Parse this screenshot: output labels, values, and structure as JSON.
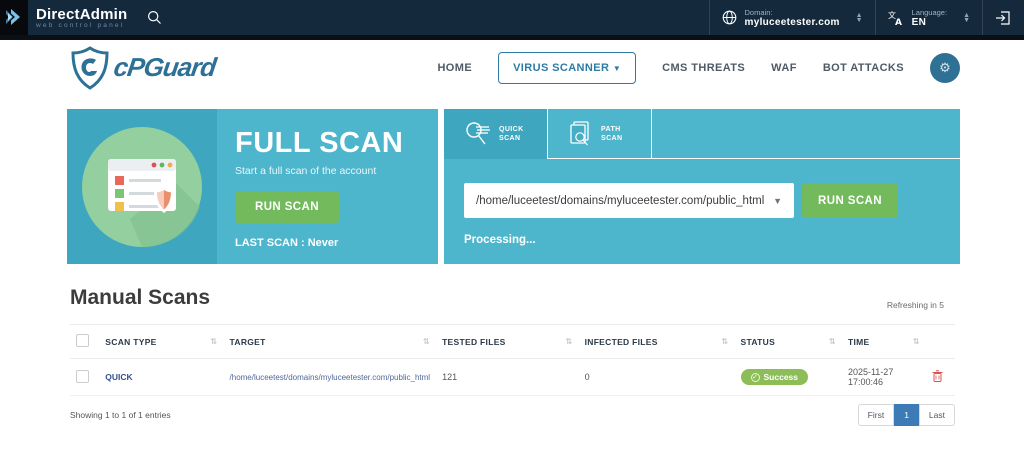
{
  "topbar": {
    "brand": "DirectAdmin",
    "brand_sub": "web control panel",
    "domain_label": "Domain:",
    "domain_value": "myluceetester.com",
    "language_label": "Language:",
    "language_value": "EN"
  },
  "nav": {
    "logo_text": "cPGuard",
    "items": {
      "home": "HOME",
      "virus_scanner": "VIRUS SCANNER",
      "cms_threats": "CMS THREATS",
      "waf": "WAF",
      "bot_attacks": "BOT ATTACKS"
    }
  },
  "full_scan": {
    "title": "FULL SCAN",
    "subtitle": "Start a full scan of the account",
    "run_button": "RUN SCAN",
    "last_scan": "LAST SCAN : Never"
  },
  "scan_panel": {
    "tab_quick": "QUICK SCAN",
    "tab_path": "PATH SCAN",
    "path_value": "/home/luceetest/domains/myluceetester.com/public_html",
    "run_button": "RUN SCAN",
    "status_text": "Processing..."
  },
  "manual_scans": {
    "title": "Manual Scans",
    "refresh_text": "Refreshing in 5",
    "columns": {
      "scan_type": "SCAN TYPE",
      "target": "TARGET",
      "tested_files": "TESTED FILES",
      "infected_files": "INFECTED FILES",
      "status": "STATUS",
      "time": "TIME"
    },
    "rows": [
      {
        "scan_type": "QUICK",
        "target": "/home/luceetest/domains/myluceetester.com/public_html",
        "tested_files": "121",
        "infected_files": "0",
        "status": "Success",
        "time": "2025-11-27 17:00:46"
      }
    ],
    "showing_text": "Showing 1 to 1 of 1 entries",
    "pagination": {
      "first": "First",
      "page": "1",
      "last": "Last"
    }
  },
  "colors": {
    "topbar_bg": "#15293d",
    "teal_light": "#4db5cc",
    "teal_dark": "#3ea7bf",
    "green_button": "#72ba5b",
    "success_pill": "#8cbd56",
    "accent_blue": "#2e7ba3",
    "pager_active": "#3c7bb5"
  }
}
